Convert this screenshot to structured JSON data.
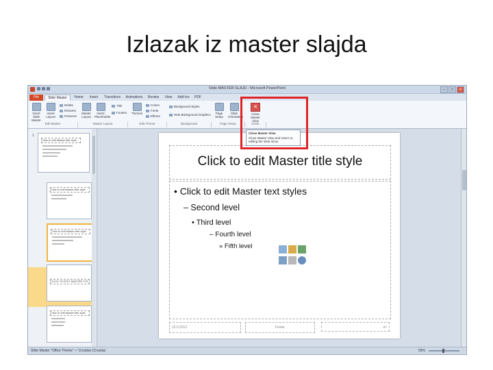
{
  "slide_title": "Izlazak iz master slajda",
  "window": {
    "title": "Slide MASTER SLAJD - Microsoft PowerPoint",
    "controls": [
      "–",
      "□",
      "✕"
    ]
  },
  "tabs": [
    "File",
    "Slide Master",
    "Home",
    "Insert",
    "Transitions",
    "Animations",
    "Review",
    "View",
    "Add-Ins",
    "PDF"
  ],
  "ribbon": {
    "buttons": [
      {
        "label": "Insert Slide Master"
      },
      {
        "label": "Insert Layout"
      },
      {
        "label": "Master Layout"
      },
      {
        "label": "Insert Placeholder"
      },
      {
        "label": "Themes"
      },
      {
        "label": "Page Setup"
      },
      {
        "label": "Slide Orientation"
      }
    ],
    "small_items": [
      "Delete",
      "Rename",
      "Preserve",
      "Title",
      "Footers",
      "Colors",
      "Fonts",
      "Effects",
      "Background Styles",
      "Hide Background Graphics"
    ],
    "groups": [
      "Edit Master",
      "Master Layout",
      "Edit Theme",
      "Background",
      "Page Setup",
      "Close"
    ],
    "close_button": "Close Master View"
  },
  "tooltip": {
    "title": "Close Master View",
    "text": "Close Master View and return to editing the slide show."
  },
  "thumbnails": [
    {
      "num": "1",
      "title": "Click to edit Master title style"
    },
    {
      "num": "",
      "title": "Click to edit Master title style"
    },
    {
      "num": "",
      "title": "Click to edit Master title style"
    },
    {
      "num": "",
      "title": "CLICK TO EDIT MASTER TITLE STYLE"
    },
    {
      "num": "",
      "title": "Click to edit Master title style"
    }
  ],
  "slide": {
    "title": "Click to edit Master title style",
    "level1": "• Click to edit Master text styles",
    "level2": "– Second level",
    "level3": "• Third level",
    "level4": "– Fourth level",
    "level5": "» Fifth level",
    "footer_date": "12.5.2012",
    "footer_text": "Footer",
    "footer_num": "‹#›"
  },
  "status": {
    "left": "Slide Master   \"Office Theme\"   ✓  Croatian (Croatia)",
    "zoom": "55%"
  }
}
